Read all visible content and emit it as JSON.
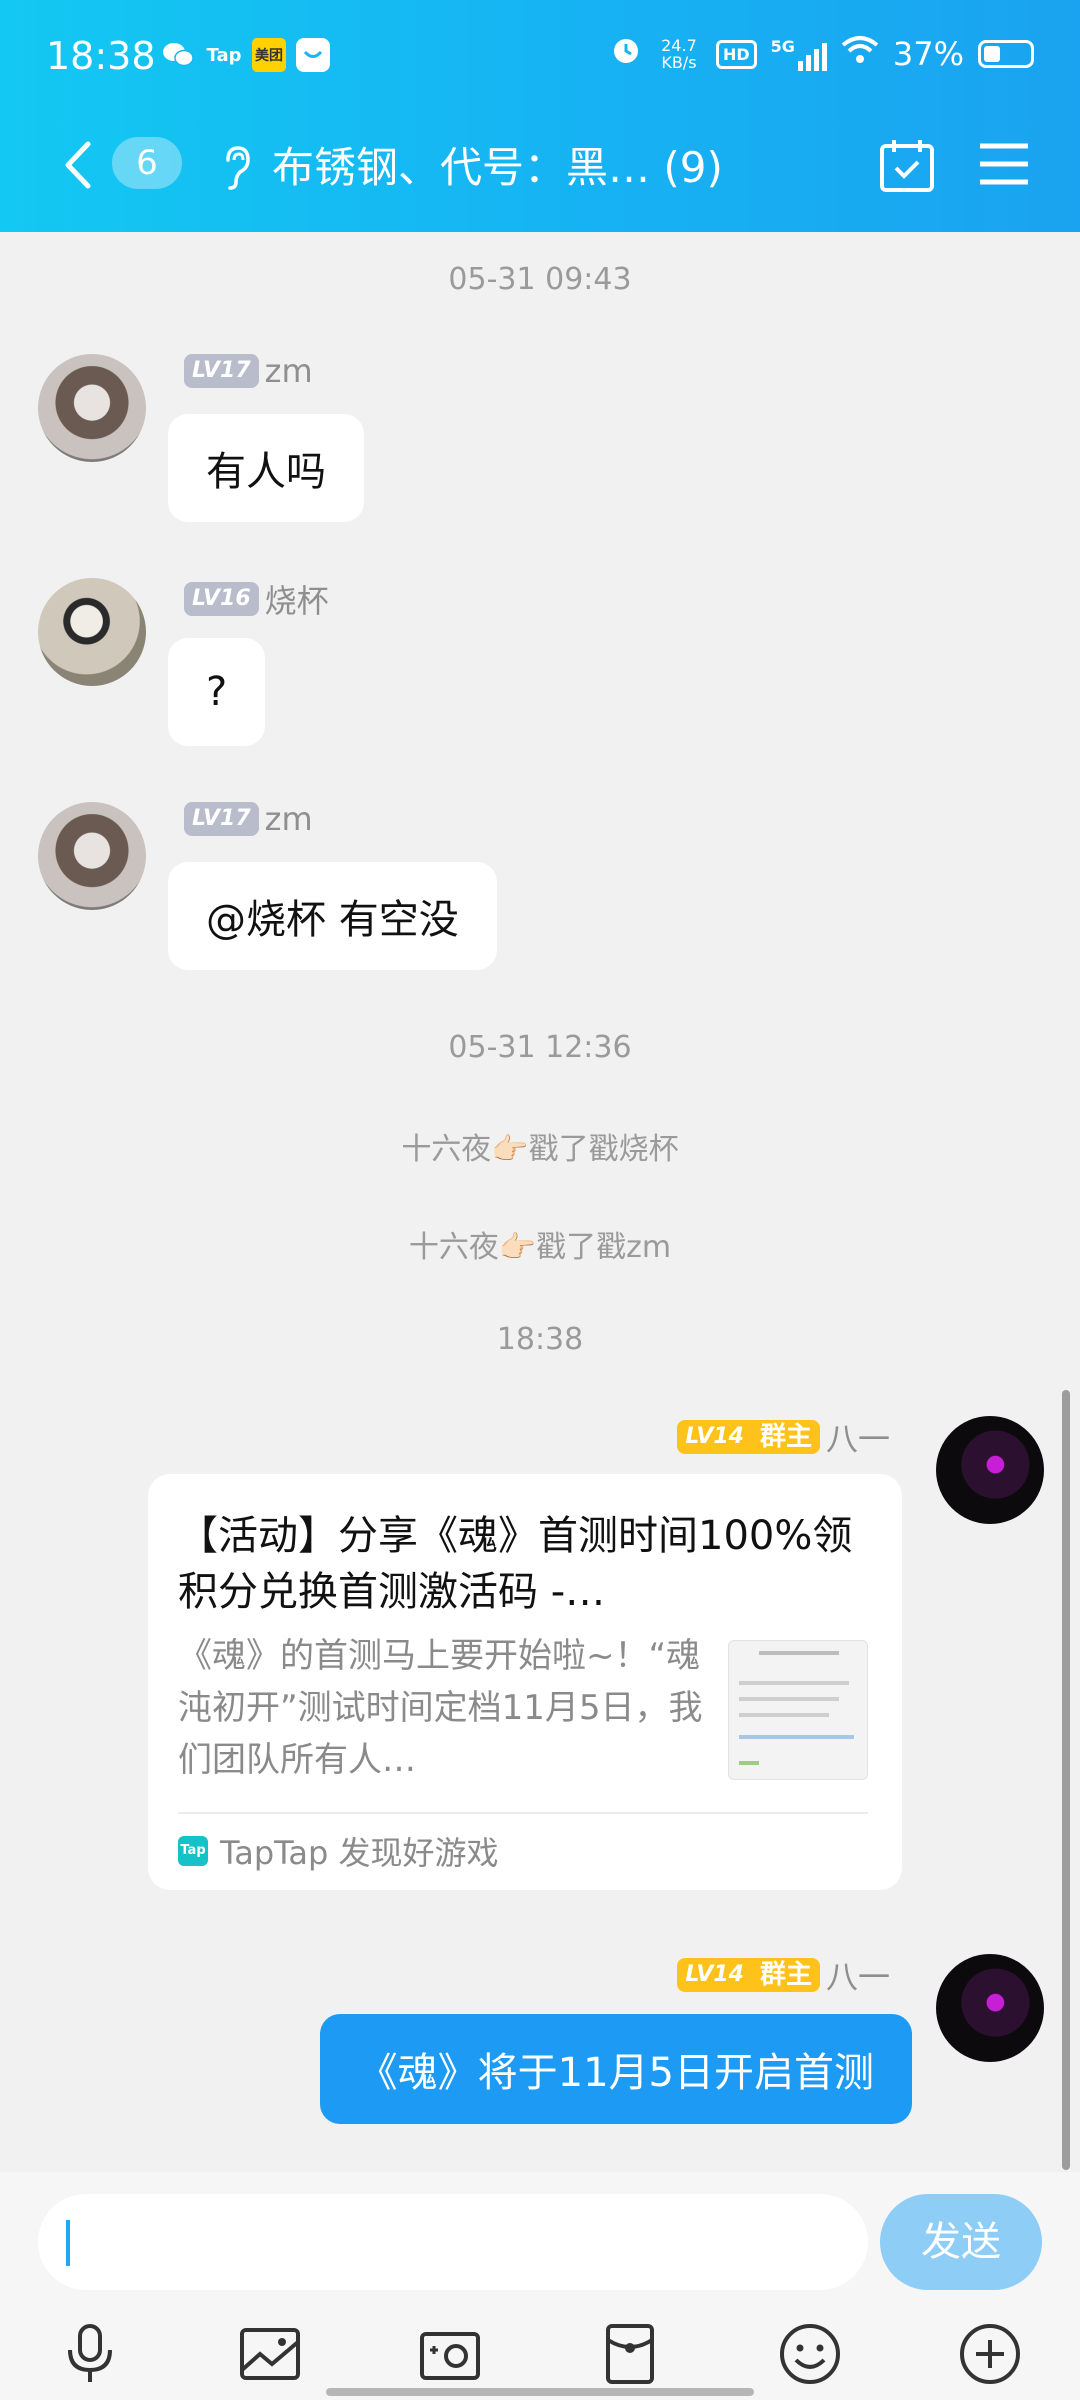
{
  "status_bar": {
    "time": "18:38",
    "app_icons": [
      "wechat-icon",
      "taptap-icon",
      "meituan-icon",
      "message-icon"
    ],
    "net_speed": "24.7 KB/s",
    "hd": "HD",
    "network": "5G",
    "battery": "37%"
  },
  "header": {
    "unread_count": "6",
    "title": "布锈钢、代号：黑… (9)",
    "accent": "#13c8f2"
  },
  "messages": {
    "ts1": "05-31 09:43",
    "m1": {
      "level": "LV17",
      "name": "zm",
      "text": "有人吗"
    },
    "m2": {
      "level": "LV16",
      "name": "烧杯",
      "text": "?"
    },
    "m3": {
      "level": "LV17",
      "name": "zm",
      "text": "@烧杯 有空没"
    },
    "ts2": "05-31 12:36",
    "sys1": "十六夜👉🏻戳了戳烧杯",
    "sys2": "十六夜👉🏻戳了戳zm",
    "ts3": "18:38",
    "m4": {
      "level": "LV14",
      "role": "群主",
      "name": "八一",
      "card_title": "【活动】分享《魂》首测时间100%领积分兑换首测激活码 -…",
      "card_desc": "《魂》的首测马上要开始啦~！“魂沌初开”测试时间定档11月5日，我们团队所有人…",
      "card_source": "TapTap 发现好游戏"
    },
    "m5": {
      "level": "LV14",
      "role": "群主",
      "name": "八一",
      "text": "《魂》将于11月5日开启首测"
    }
  },
  "input": {
    "placeholder": "",
    "send_label": "发送"
  },
  "toolbar": [
    "mic-icon",
    "image-icon",
    "camera-icon",
    "red-packet-icon",
    "emoji-icon",
    "plus-icon"
  ]
}
